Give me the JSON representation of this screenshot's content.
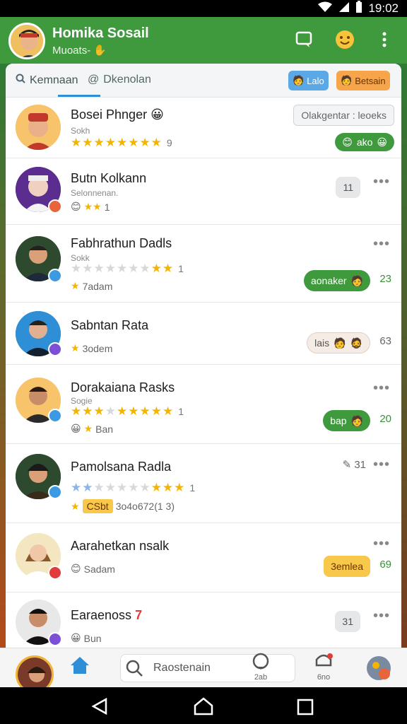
{
  "status": {
    "time": "19:02"
  },
  "header": {
    "title": "Homika Sosail",
    "subtitle": "Muoats-"
  },
  "tabs": [
    {
      "label": "Kemnaan"
    },
    {
      "label": "Dkenolan"
    }
  ],
  "tab_tags": [
    {
      "label": "Lalo"
    },
    {
      "label": "Betsain"
    }
  ],
  "colors": {
    "header": "#3f9a3e",
    "accent_green": "#3f9a3e",
    "tab_active": "#2f8fd6"
  },
  "contacts": [
    {
      "name": "Bosei Phnger",
      "sub": "Sokh",
      "input_text": "Olakgentar : leoeks",
      "pill": "ako",
      "stars": "9",
      "badge": "none"
    },
    {
      "name": "Butn Kolkann",
      "sub": "Selonnenan.",
      "meta": "1",
      "count": "11",
      "badge": "orange"
    },
    {
      "name": "Fabhrathun Dadls",
      "sub": "Sokk",
      "stars": "1",
      "meta": "7adam",
      "pill": "aonaker",
      "side": "23",
      "badge": "blue"
    },
    {
      "name": "Sabntan Rata",
      "meta": "3odem",
      "pill": "lais",
      "side": "63",
      "badge": "purple"
    },
    {
      "name": "Dorakaiana Rasks",
      "sub": "Sogie",
      "stars": "1",
      "meta": "Ban",
      "pill": "bap",
      "side": "20",
      "badge": "blue"
    },
    {
      "name": "Pamolsana Radla",
      "stars": "1",
      "meta": "3o4o672(1 3)",
      "tag": "CSbt",
      "side_label": "31",
      "badge": "blue"
    },
    {
      "name": "Aarahetkan nsalk",
      "meta": "Sadam",
      "pill": "3emlea",
      "side": "69",
      "badge": "red"
    },
    {
      "name": "Earaenoss",
      "name_mark": "7",
      "meta": "Bun",
      "count": "31",
      "badge": "purple"
    }
  ],
  "bottom_nav": {
    "search": "Raostenain",
    "items": [
      {
        "label": "2ab"
      },
      {
        "label": "6no"
      }
    ]
  }
}
